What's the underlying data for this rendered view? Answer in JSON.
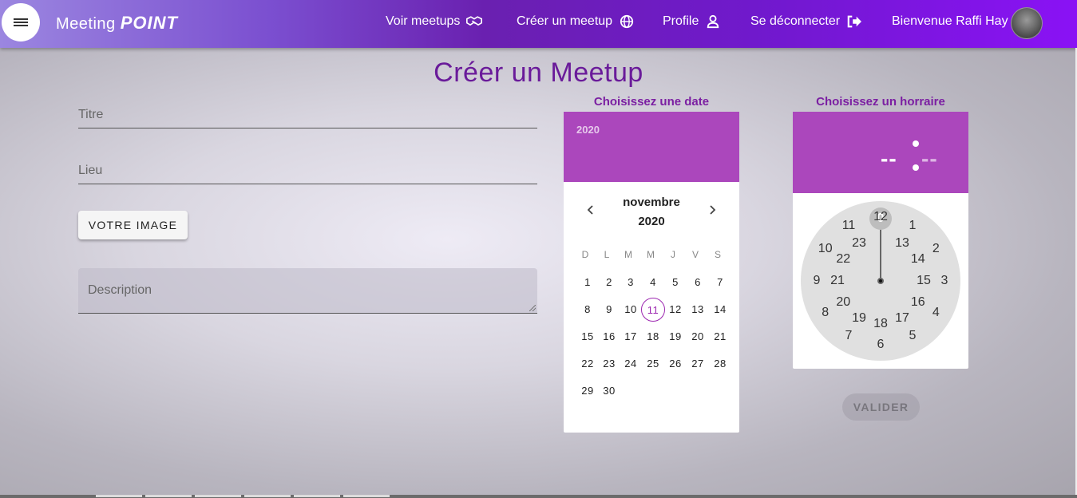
{
  "header": {
    "brand_plain": "Meeting",
    "brand_strong": "POINT",
    "nav": [
      {
        "label": "Voir meetups",
        "icon": "handshake-icon"
      },
      {
        "label": "Créer un meetup",
        "icon": "globe-icon"
      },
      {
        "label": "Profile",
        "icon": "user-icon"
      },
      {
        "label": "Se déconnecter",
        "icon": "logout-icon"
      }
    ],
    "welcome": "Bienvenue Raffi Hay"
  },
  "page": {
    "title": "Créer un Meetup"
  },
  "form": {
    "title_label": "Titre",
    "lieu_label": "Lieu",
    "image_button": "VOTRE IMAGE",
    "description_label": "Description"
  },
  "datepicker": {
    "label": "Choisissez une date",
    "year": "2020",
    "month": "novembre",
    "month_year": "2020",
    "weekdays": [
      "D",
      "L",
      "M",
      "M",
      "J",
      "V",
      "S"
    ],
    "weeks": [
      [
        "1",
        "2",
        "3",
        "4",
        "5",
        "6",
        "7"
      ],
      [
        "8",
        "9",
        "10",
        "11",
        "12",
        "13",
        "14"
      ],
      [
        "15",
        "16",
        "17",
        "18",
        "19",
        "20",
        "21"
      ],
      [
        "22",
        "23",
        "24",
        "25",
        "26",
        "27",
        "28"
      ],
      [
        "29",
        "30"
      ]
    ],
    "today": "11"
  },
  "timepicker": {
    "label": "Choisissez un horraire",
    "hours_display": "--",
    "minutes_display": "--",
    "selected": "0",
    "outer": [
      "12",
      "1",
      "2",
      "3",
      "4",
      "5",
      "6",
      "7",
      "8",
      "9",
      "10",
      "11"
    ],
    "inner": [
      "13",
      "14",
      "15",
      "16",
      "17",
      "18",
      "19",
      "20",
      "21",
      "22",
      "23"
    ]
  },
  "actions": {
    "valider": "VALIDER"
  },
  "colors": {
    "accent": "#ab47bc",
    "title": "#6a1b9a",
    "appbar_end": "#8a12f5"
  }
}
